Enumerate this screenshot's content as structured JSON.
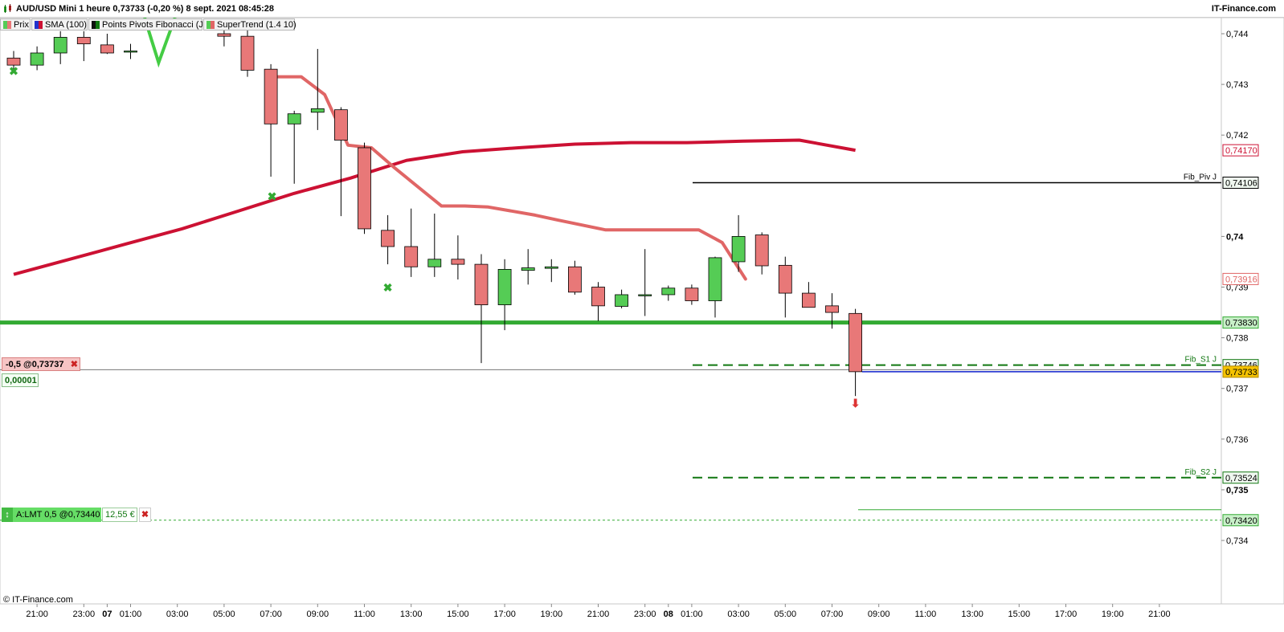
{
  "header": {
    "title": "AUD/USD Mini 1 heure 0,73733 (-0,20 %) 8 sept. 2021 08:45:28",
    "brand": "IT-Finance.com"
  },
  "legend": [
    {
      "label": "Prix",
      "color": "#55cc55"
    },
    {
      "label": "SMA (100)",
      "color": "#2233cc"
    },
    {
      "label": "Points Pivots Fibonacci (J)",
      "color": "#117711"
    },
    {
      "label": "SuperTrend (1.4 10)",
      "color": "#e06666"
    }
  ],
  "position_box": {
    "label": "-0,5 @0,73737",
    "close": "✖",
    "value": "0,00001"
  },
  "order_box": {
    "label": "A:LMT  0,5 @0,73440",
    "amount": "12,55 €",
    "close": "✖"
  },
  "copyright": "© IT-Finance.com",
  "colors": {
    "up": "#55cc55",
    "down": "#e87878",
    "sma": "#cc1133",
    "supertrend": "#e06666",
    "support": "#33aa33"
  },
  "chart_data": {
    "type": "candlestick",
    "instrument": "AUD/USD Mini",
    "timeframe": "1 heure",
    "y_range": [
      0.7336,
      0.7446
    ],
    "y_ticks": [
      "0,744",
      "0,743",
      "0,742",
      "0,74",
      "0,739",
      "0,738",
      "0,737",
      "0,736",
      "0,735",
      "0,734"
    ],
    "x_ticks": [
      "21:00",
      "23:00",
      "07",
      "01:00",
      "03:00",
      "05:00",
      "07:00",
      "09:00",
      "11:00",
      "13:00",
      "15:00",
      "17:00",
      "19:00",
      "21:00",
      "23:00",
      "08",
      "01:00",
      "03:00",
      "05:00",
      "07:00",
      "09:00",
      "11:00",
      "13:00",
      "15:00",
      "17:00",
      "19:00",
      "21:00"
    ],
    "candles": [
      {
        "t": "20:00",
        "o": 0.74352,
        "h": 0.74366,
        "l": 0.74328,
        "c": 0.74338
      },
      {
        "t": "21:00",
        "o": 0.74338,
        "h": 0.74375,
        "l": 0.74328,
        "c": 0.74362
      },
      {
        "t": "22:00",
        "o": 0.74362,
        "h": 0.74405,
        "l": 0.7434,
        "c": 0.74393
      },
      {
        "t": "23:00",
        "o": 0.74393,
        "h": 0.74405,
        "l": 0.74346,
        "c": 0.7438
      },
      {
        "t": "00:00",
        "o": 0.74378,
        "h": 0.744,
        "l": 0.7436,
        "c": 0.74362
      },
      {
        "t": "01:00",
        "o": 0.74366,
        "h": 0.7438,
        "l": 0.7435,
        "c": 0.74366
      },
      {
        "t": "05:00",
        "o": 0.744,
        "h": 0.7441,
        "l": 0.74375,
        "c": 0.74395
      },
      {
        "t": "06:00",
        "o": 0.74395,
        "h": 0.7441,
        "l": 0.74315,
        "c": 0.74328
      },
      {
        "t": "07:00",
        "o": 0.7433,
        "h": 0.7434,
        "l": 0.74118,
        "c": 0.74222
      },
      {
        "t": "08:00",
        "o": 0.74222,
        "h": 0.74248,
        "l": 0.74104,
        "c": 0.74242
      },
      {
        "t": "09:00",
        "o": 0.74245,
        "h": 0.7437,
        "l": 0.7421,
        "c": 0.74252
      },
      {
        "t": "10:00",
        "o": 0.7425,
        "h": 0.74255,
        "l": 0.7404,
        "c": 0.7419
      },
      {
        "t": "11:00",
        "o": 0.74175,
        "h": 0.74185,
        "l": 0.74005,
        "c": 0.74015
      },
      {
        "t": "12:00",
        "o": 0.74012,
        "h": 0.74042,
        "l": 0.73945,
        "c": 0.7398
      },
      {
        "t": "13:00",
        "o": 0.7398,
        "h": 0.74055,
        "l": 0.7392,
        "c": 0.7394
      },
      {
        "t": "14:00",
        "o": 0.7394,
        "h": 0.74045,
        "l": 0.7392,
        "c": 0.73955
      },
      {
        "t": "15:00",
        "o": 0.73955,
        "h": 0.74002,
        "l": 0.73915,
        "c": 0.73945
      },
      {
        "t": "16:00",
        "o": 0.73945,
        "h": 0.73965,
        "l": 0.7375,
        "c": 0.73865
      },
      {
        "t": "17:00",
        "o": 0.73865,
        "h": 0.73955,
        "l": 0.73815,
        "c": 0.73935
      },
      {
        "t": "18:00",
        "o": 0.73933,
        "h": 0.73975,
        "l": 0.73905,
        "c": 0.73938
      },
      {
        "t": "19:00",
        "o": 0.73937,
        "h": 0.73955,
        "l": 0.7391,
        "c": 0.7394
      },
      {
        "t": "20:00",
        "o": 0.7394,
        "h": 0.73952,
        "l": 0.73885,
        "c": 0.7389
      },
      {
        "t": "21:00",
        "o": 0.739,
        "h": 0.7391,
        "l": 0.73833,
        "c": 0.73863
      },
      {
        "t": "22:00",
        "o": 0.73862,
        "h": 0.73895,
        "l": 0.73858,
        "c": 0.73885
      },
      {
        "t": "23:00",
        "o": 0.73883,
        "h": 0.73975,
        "l": 0.73843,
        "c": 0.73885
      },
      {
        "t": "00:00",
        "o": 0.73885,
        "h": 0.73903,
        "l": 0.73873,
        "c": 0.73898
      },
      {
        "t": "01:00",
        "o": 0.73898,
        "h": 0.73905,
        "l": 0.73865,
        "c": 0.73873
      },
      {
        "t": "02:00",
        "o": 0.73873,
        "h": 0.7396,
        "l": 0.7384,
        "c": 0.73958
      },
      {
        "t": "03:00",
        "o": 0.7395,
        "h": 0.74042,
        "l": 0.7393,
        "c": 0.74
      },
      {
        "t": "04:00",
        "o": 0.74003,
        "h": 0.74008,
        "l": 0.73925,
        "c": 0.73942
      },
      {
        "t": "05:00",
        "o": 0.73943,
        "h": 0.7396,
        "l": 0.7384,
        "c": 0.73888
      },
      {
        "t": "06:00",
        "o": 0.73888,
        "h": 0.7391,
        "l": 0.73865,
        "c": 0.7386
      },
      {
        "t": "07:00",
        "o": 0.73863,
        "h": 0.73888,
        "l": 0.73818,
        "c": 0.7385
      },
      {
        "t": "08:00",
        "o": 0.73848,
        "h": 0.73857,
        "l": 0.73685,
        "c": 0.73733
      }
    ],
    "sma": [
      0.73925,
      0.73955,
      0.73985,
      0.74015,
      0.7405,
      0.74085,
      0.74115,
      0.7415,
      0.74167,
      0.74175,
      0.74182,
      0.74185,
      0.74185,
      0.74188,
      0.7419,
      0.7417
    ],
    "supertrend": [
      0.74315,
      0.74315,
      0.7428,
      0.7418,
      0.74175,
      0.74135,
      0.7406,
      0.7406,
      0.74058,
      0.74042,
      0.74032,
      0.74013,
      0.74013,
      0.74013,
      0.73988,
      0.73916
    ],
    "levels": [
      {
        "name": "Fib_Piv J",
        "value": 0.74106,
        "label": "0,74106",
        "style": "solid",
        "color": "#000000"
      },
      {
        "name": "Fib_S1 J",
        "value": 0.73746,
        "label": "0,73746",
        "style": "dashed",
        "color": "#117711"
      },
      {
        "name": "Fib_S2 J",
        "value": 0.73524,
        "label": "0,73524",
        "style": "dashed",
        "color": "#117711"
      },
      {
        "name": "Support",
        "value": 0.7383,
        "label": "0,73830",
        "style": "thick",
        "color": "#33aa33"
      }
    ],
    "price_tags": [
      {
        "label": "0,74170",
        "value": 0.7417,
        "kind": "sma"
      },
      {
        "label": "0,73916",
        "value": 0.73916,
        "kind": "supertrend"
      },
      {
        "label": "0,73733",
        "value": 0.73733,
        "kind": "last"
      },
      {
        "label": "0,73420",
        "value": 0.7342,
        "kind": "order"
      }
    ],
    "last_price": 0.73733,
    "position_price": 0.73737,
    "order_price": 0.7344
  }
}
